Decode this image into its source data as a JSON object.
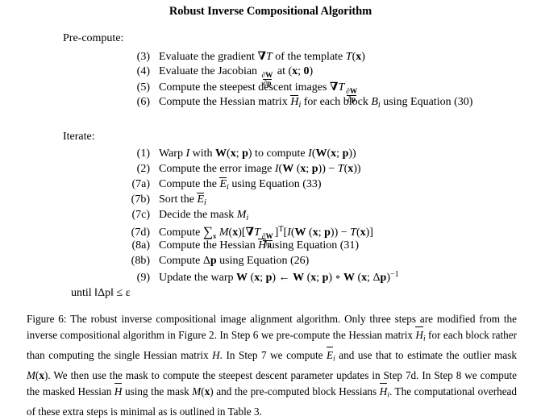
{
  "document": {
    "title": "Robust Inverse Compositional Algorithm",
    "precompute_label": "Pre-compute:",
    "iterate_label": "Iterate:",
    "until_text": "until ‖Δp‖ ≤ ε"
  },
  "precompute_steps": [
    {
      "number": "(3)",
      "text": "Evaluate the gradient ∇T of the template T(x)"
    },
    {
      "number": "(4)",
      "text": "Evaluate the Jacobian ∂W/∂p at (x; 0)"
    },
    {
      "number": "(5)",
      "text": "Compute the steepest descent images ∇T ∂W/∂p"
    },
    {
      "number": "(6)",
      "text": "Compute the Hessian matrix H̄i for each block Bi using Equation (30)"
    }
  ],
  "iterate_steps": [
    {
      "number": "(1)",
      "text": "Warp I with W(x; p) to compute I(W(x; p))"
    },
    {
      "number": "(2)",
      "text": "Compute the error image I(W(x; p)) − T(x))"
    },
    {
      "number": "(7a)",
      "text": "Compute the Ēi using Equation (33)"
    },
    {
      "number": "(7b)",
      "text": "Sort the Ēi"
    },
    {
      "number": "(7c)",
      "text": "Decide the mask Mi"
    },
    {
      "number": "(7d)",
      "text": "Compute Σx M(x)[∇T ∂W/∂p]T[I(W(x; p)) − T(x)]"
    },
    {
      "number": "(8a)",
      "text": "Compute the Hessian H̄ using Equation (31)"
    },
    {
      "number": "(8b)",
      "text": "Compute Δp using Equation (26)"
    },
    {
      "number": "(9)",
      "text": "Update the warp W(x; p) ← W(x; p) ∘ W(x; Δp)−1"
    }
  ],
  "caption": {
    "label": "Figure 6:",
    "body": "The robust inverse compositional image alignment algorithm. Only three steps are modified from the inverse compositional algorithm in Figure 2. In Step 6 we pre-compute the Hessian matrix H̄i for each block rather than computing the single Hessian matrix H. In Step 7 we compute Ēi and use that to estimate the outlier mask M(x). We then use the mask to compute the steepest descent parameter updates in Step 7d. In Step 8 we compute the masked Hessian H̄ using the mask M(x) and the pre-computed block Hessians H̄i. The computational overhead of these extra steps is minimal as is outlined in Table 3."
  },
  "colors": {
    "text": "#000000",
    "background": "#ffffff"
  }
}
